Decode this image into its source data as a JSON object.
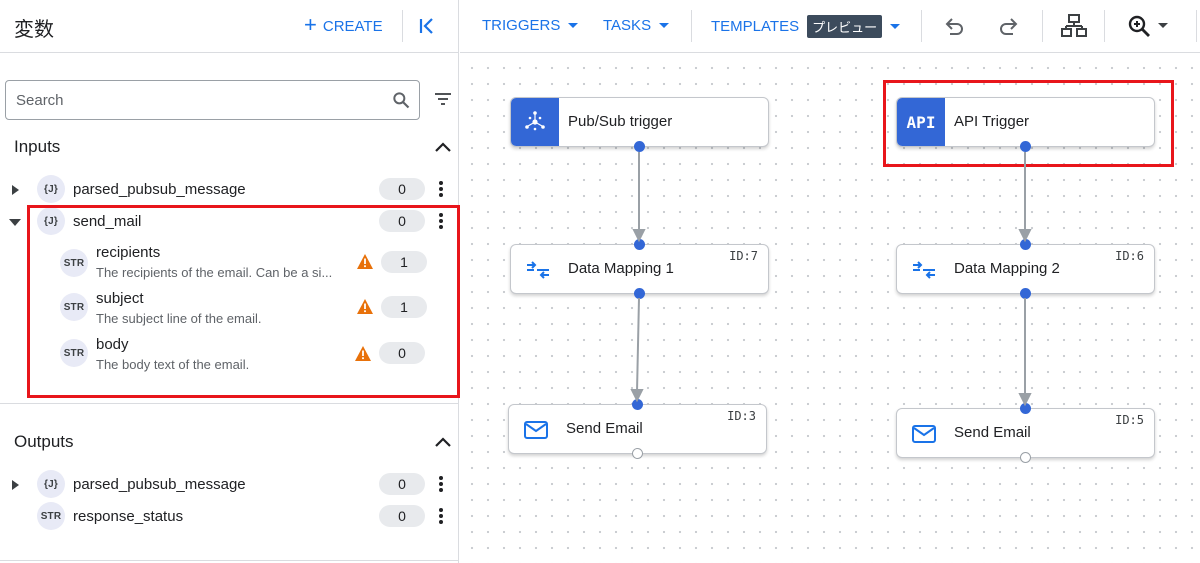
{
  "left_panel": {
    "title": "変数",
    "create_label": "CREATE",
    "search_placeholder": "Search",
    "inputs": {
      "title": "Inputs",
      "items": [
        {
          "type": "{J}",
          "name": "parsed_pubsub_message",
          "count": "0"
        },
        {
          "type": "{J}",
          "name": "send_mail",
          "count": "0",
          "children": [
            {
              "type": "STR",
              "name": "recipients",
              "desc": "The recipients of the email. Can be a si...",
              "count": "1"
            },
            {
              "type": "STR",
              "name": "subject",
              "desc": "The subject line of the email.",
              "count": "1"
            },
            {
              "type": "STR",
              "name": "body",
              "desc": "The body text of the email.",
              "count": "0"
            }
          ]
        }
      ]
    },
    "outputs": {
      "title": "Outputs",
      "items": [
        {
          "type": "{J}",
          "name": "parsed_pubsub_message",
          "count": "0"
        },
        {
          "type": "STR",
          "name": "response_status",
          "count": "0"
        }
      ]
    }
  },
  "toolbar": {
    "triggers_label": "TRIGGERS",
    "tasks_label": "TASKS",
    "templates_label": "TEMPLATES",
    "preview_badge": "プレビュー"
  },
  "canvas": {
    "nodes": [
      {
        "title": "Pub/Sub trigger",
        "kind": "trigger",
        "icon": "pubsub-icon"
      },
      {
        "title": "API Trigger",
        "kind": "trigger",
        "icon": "api-icon",
        "icon_text": "API"
      },
      {
        "title": "Data Mapping 1",
        "kind": "task",
        "icon": "data-mapping-icon",
        "id": "ID:7"
      },
      {
        "title": "Data Mapping 2",
        "kind": "task",
        "icon": "data-mapping-icon",
        "id": "ID:6"
      },
      {
        "title": "Send Email",
        "kind": "task",
        "icon": "mail-icon",
        "id": "ID:3"
      },
      {
        "title": "Send Email",
        "kind": "task",
        "icon": "mail-icon",
        "id": "ID:5"
      }
    ]
  },
  "colors": {
    "accent": "#1a73e8",
    "trigger_block": "#3367d6",
    "highlight": "#e8151b",
    "warning": "#e8710a"
  }
}
